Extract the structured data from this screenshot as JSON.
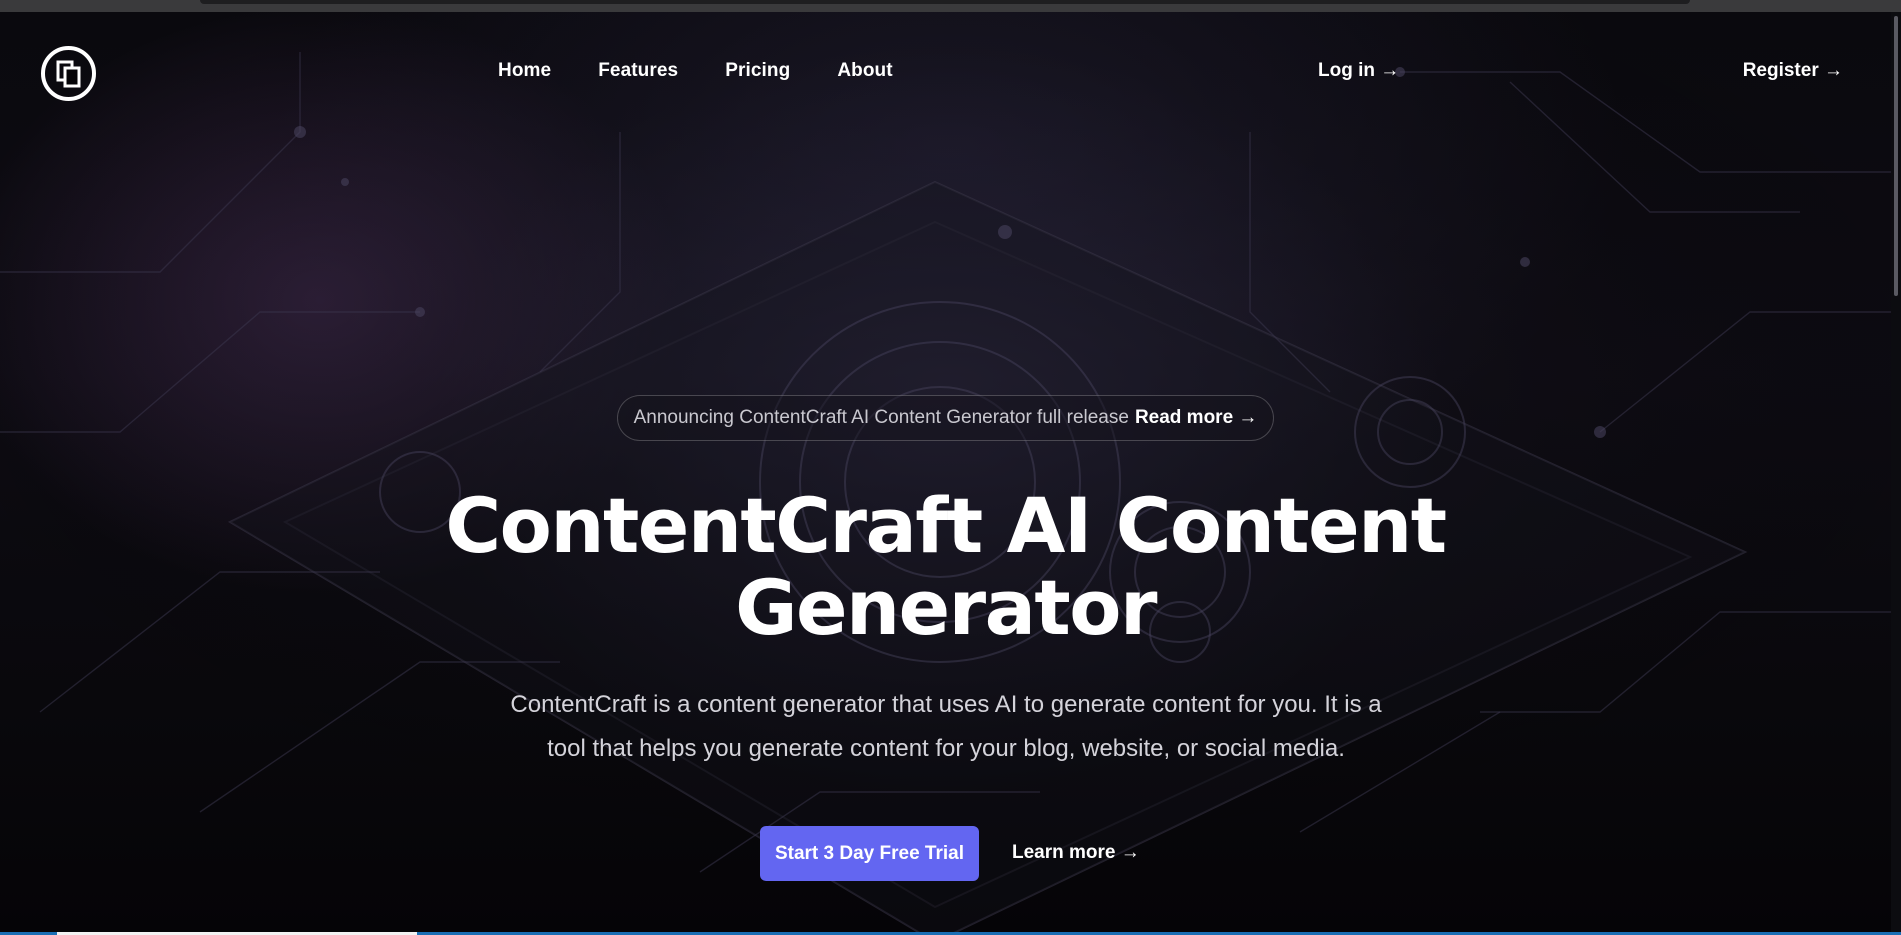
{
  "nav": {
    "logo_icon": "copy-square-logo-icon",
    "links": [
      {
        "label": "Home"
      },
      {
        "label": "Features"
      },
      {
        "label": "Pricing"
      },
      {
        "label": "About"
      }
    ],
    "login_label": "Log in →",
    "register_label": "Register →"
  },
  "hero": {
    "announcement": {
      "text": "Announcing ContentCraft AI Content Generator full release",
      "link_label": "Read more →"
    },
    "title_line1": "ContentCraft AI Content",
    "title_line2": "Generator",
    "subtitle_line1": "ContentCraft is a content generator that uses AI to generate content for you. It is a",
    "subtitle_line2": "tool that helps you generate content for your blog, website, or social media.",
    "primary_cta": "Start 3 Day Free Trial",
    "secondary_cta": "Learn more →"
  },
  "page_load_progress": 0.16,
  "colors": {
    "accent": "#6366f1",
    "background": "#0a090e",
    "text": "#ffffff",
    "muted_text": "#d4d3da"
  }
}
